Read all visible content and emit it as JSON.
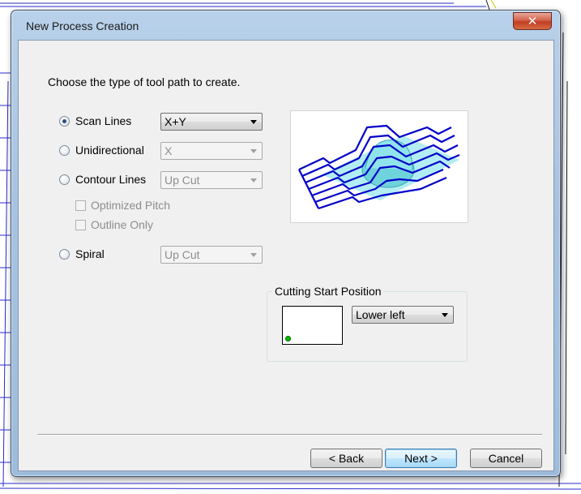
{
  "window": {
    "title": "New Process Creation",
    "close_glyph": "✕"
  },
  "prompt": "Choose the type of tool path to create.",
  "options": {
    "scan_lines": {
      "label": "Scan Lines",
      "checked": true,
      "select_value": "X+Y",
      "enabled": true
    },
    "unidirectional": {
      "label": "Unidirectional",
      "checked": false,
      "select_value": "X",
      "enabled": false
    },
    "contour_lines": {
      "label": "Contour Lines",
      "checked": false,
      "select_value": "Up Cut",
      "enabled": false
    },
    "optimized_pitch": {
      "label": "Optimized Pitch",
      "checked": false,
      "enabled": false
    },
    "outline_only": {
      "label": "Outline Only",
      "checked": false,
      "enabled": false
    },
    "spiral": {
      "label": "Spiral",
      "checked": false,
      "select_value": "Up Cut",
      "enabled": false
    }
  },
  "cutting_start": {
    "group_label": "Cutting Start Position",
    "select_value": "Lower left"
  },
  "buttons": {
    "back": "< Back",
    "next": "Next >",
    "cancel": "Cancel"
  },
  "colors": {
    "toolpath": "#0000c8",
    "surface": "#8fe4ec",
    "start_dot": "#00c000"
  }
}
